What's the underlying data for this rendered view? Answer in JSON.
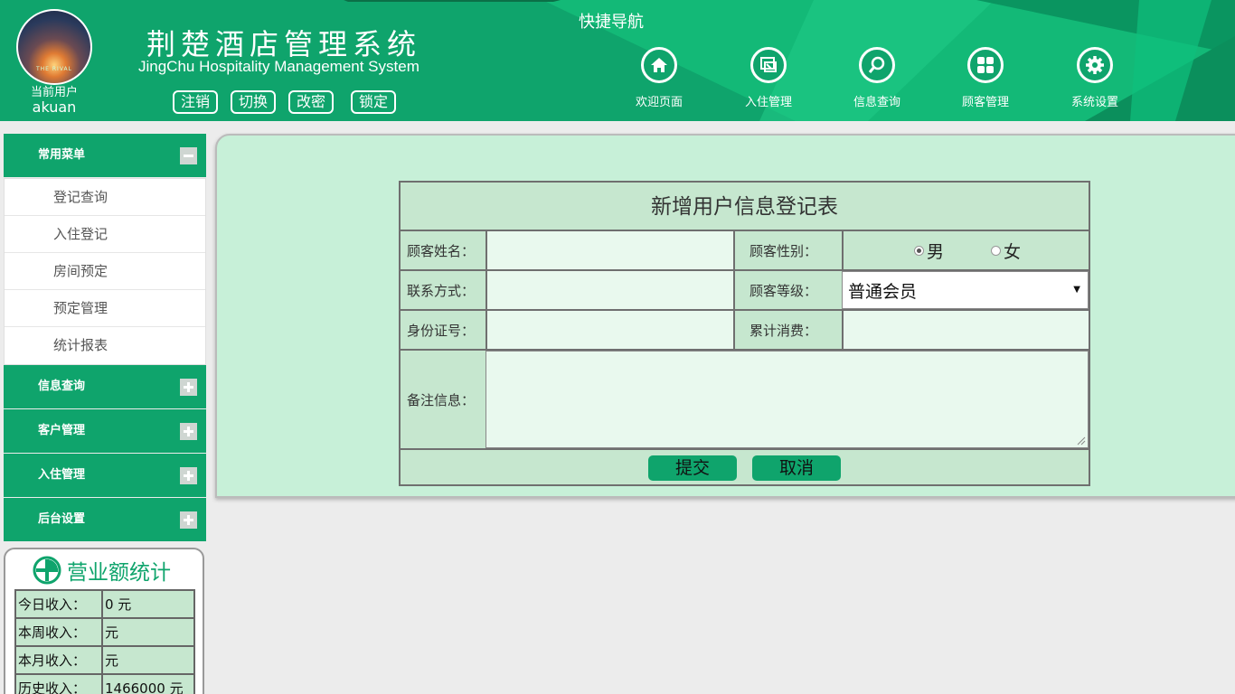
{
  "header": {
    "avatar_tag": "THE RIVAL",
    "user_label": "当前用户",
    "user_name": "akuan",
    "title": "荆楚酒店管理系统",
    "subtitle": "JingChu Hospitality Management System",
    "actions": [
      "注销",
      "切换",
      "改密",
      "锁定"
    ],
    "quick_nav_title": "快捷导航",
    "nav": [
      {
        "label": "欢迎页面",
        "icon": "home-icon"
      },
      {
        "label": "入住管理",
        "icon": "checkin-icon"
      },
      {
        "label": "信息查询",
        "icon": "search-icon"
      },
      {
        "label": "顾客管理",
        "icon": "grid-icon"
      },
      {
        "label": "系统设置",
        "icon": "gear-icon"
      }
    ],
    "accent": "#0fa46c"
  },
  "sidebar": {
    "groups": [
      {
        "label": "常用菜单",
        "expanded": true,
        "items": [
          "登记查询",
          "入住登记",
          "房间预定",
          "预定管理",
          "统计报表"
        ]
      },
      {
        "label": "信息查询",
        "expanded": false
      },
      {
        "label": "客户管理",
        "expanded": false
      },
      {
        "label": "入住管理",
        "expanded": false
      },
      {
        "label": "后台设置",
        "expanded": false
      }
    ]
  },
  "stats": {
    "title": "营业额统计",
    "rows": [
      {
        "label": "今日收入：",
        "value": "0 元"
      },
      {
        "label": "本周收入：",
        "value": "元"
      },
      {
        "label": "本月收入：",
        "value": "元"
      },
      {
        "label": "历史收入：",
        "value": "1466000 元"
      }
    ]
  },
  "form": {
    "title": "新增用户信息登记表",
    "name_label": "顾客姓名：",
    "gender_label": "顾客性别：",
    "gender_options": [
      "男",
      "女"
    ],
    "gender_selected": "男",
    "phone_label": "联系方式：",
    "level_label": "顾客等级：",
    "level_value": "普通会员",
    "id_label": "身份证号：",
    "spend_label": "累计消费：",
    "note_label": "备注信息：",
    "submit": "提交",
    "cancel": "取消"
  }
}
